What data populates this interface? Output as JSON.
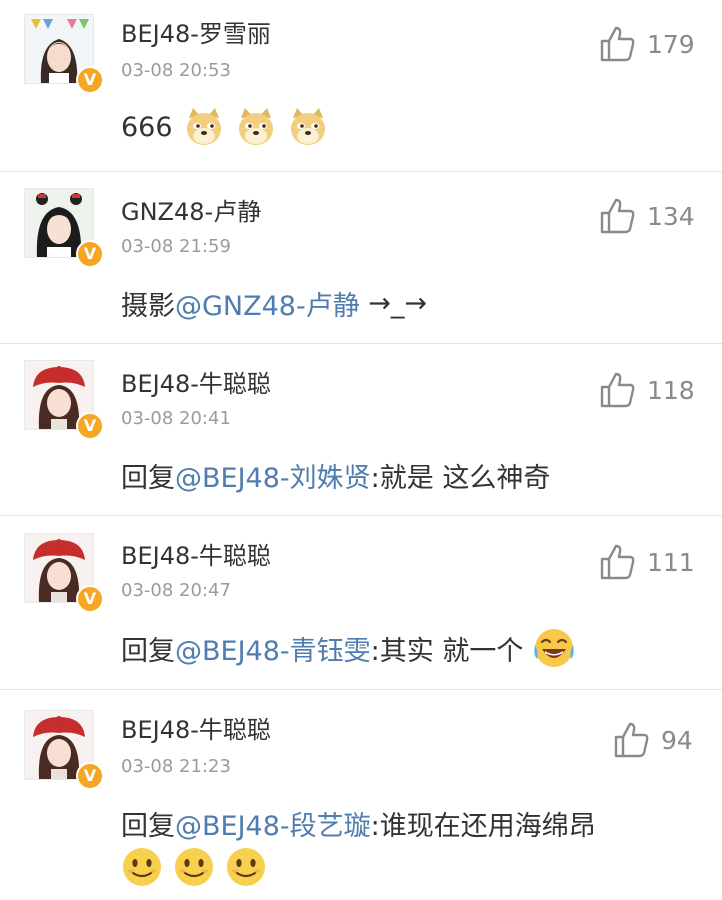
{
  "comments": [
    {
      "username": "BEJ48-罗雪丽",
      "time": "03-08 20:53",
      "likes": "179",
      "text": "666",
      "emojis": [
        "doge-emoji",
        "doge-emoji",
        "doge-emoji"
      ]
    },
    {
      "username": "GNZ48-卢静",
      "time": "03-08 21:59",
      "likes": "134",
      "prefix": "摄影",
      "mention": "@GNZ48-卢静",
      "text": " →_→"
    },
    {
      "username": "BEJ48-牛聪聪",
      "time": "03-08 20:41",
      "likes": "118",
      "prefix": "回复",
      "mention": "@BEJ48-刘姝贤",
      "text": ":就是 这么神奇"
    },
    {
      "username": "BEJ48-牛聪聪",
      "time": "03-08 20:47",
      "likes": "111",
      "prefix": "回复",
      "mention": "@BEJ48-青钰雯",
      "text": ":其实 就一个",
      "emojis": [
        "laugh-cry-emoji"
      ]
    },
    {
      "username": "BEJ48-牛聪聪",
      "time": "03-08 21:23",
      "likes": "94",
      "prefix": "回复",
      "mention": "@BEJ48-段艺璇",
      "text": ":谁现在还用海绵昂",
      "emojis": [
        "smile-emoji",
        "smile-emoji",
        "smile-emoji"
      ]
    }
  ],
  "badge": {
    "label": "V",
    "color": "#f5a623"
  },
  "colors": {
    "mention": "#507daf",
    "meta": "#9b9b9b",
    "text": "#333333"
  }
}
